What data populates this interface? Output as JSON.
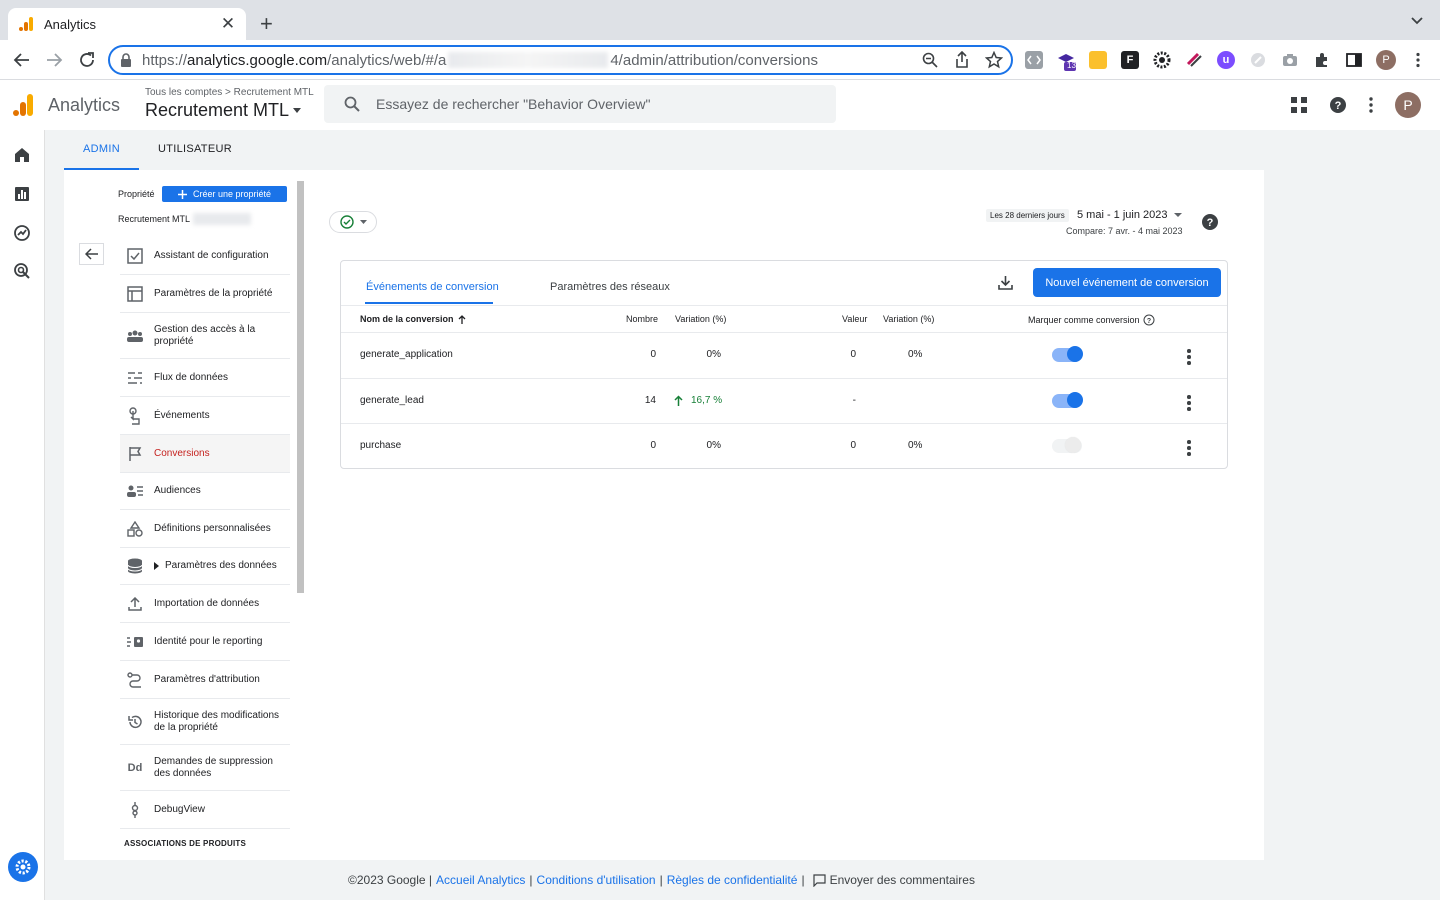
{
  "browser": {
    "tab_title": "Analytics",
    "tab_close": "✕",
    "new_tab": "+",
    "url_scheme": "https://",
    "url_host": "analytics.google.com",
    "url_prefix": "/analytics/web/#/a",
    "url_suffix": "4/admin/attribution/conversions",
    "extension_badge": "13",
    "profile_initial": "P"
  },
  "header": {
    "product": "Analytics",
    "breadcrumb_root": "Tous les comptes",
    "breadcrumb_account": "Recrutement MTL",
    "property_name": "Recrutement MTL",
    "search_placeholder": "Essayez de rechercher \"Behavior Overview\"",
    "avatar_initial": "P"
  },
  "admin_tabs": [
    "ADMIN",
    "UTILISATEUR"
  ],
  "property_bar": {
    "label": "Propriété",
    "create_button": "Créer une propriété",
    "property_name": "Recrutement MTL"
  },
  "menu": [
    {
      "label": "Assistant de configuration",
      "icon": "checklist-icon"
    },
    {
      "label": "Paramètres de la propriété",
      "icon": "property-settings-icon"
    },
    {
      "label": "Gestion des accès à la propriété",
      "icon": "people-icon"
    },
    {
      "label": "Flux de données",
      "icon": "data-streams-icon"
    },
    {
      "label": "Événements",
      "icon": "touch-icon"
    },
    {
      "label": "Conversions",
      "icon": "flag-icon"
    },
    {
      "label": "Audiences",
      "icon": "audiences-icon"
    },
    {
      "label": "Définitions personnalisées",
      "icon": "shapes-icon"
    },
    {
      "label": "Paramètres des données",
      "icon": "database-icon"
    },
    {
      "label": "Importation de données",
      "icon": "upload-icon"
    },
    {
      "label": "Identité pour le reporting",
      "icon": "identity-icon"
    },
    {
      "label": "Paramètres d'attribution",
      "icon": "attribution-icon"
    },
    {
      "label": "Historique des modifications de la propriété",
      "icon": "history-icon"
    },
    {
      "label": "Demandes de suppression des données",
      "icon": "dd-icon"
    },
    {
      "label": "DebugView",
      "icon": "debug-icon"
    }
  ],
  "products_heading": "ASSOCIATIONS DE PRODUITS",
  "date_range": {
    "badge": "Les 28 derniers jours",
    "range": "5 mai - 1 juin 2023",
    "compare": "Compare: 7 avr. - 4 mai 2023"
  },
  "card": {
    "tabs": [
      "Événements de conversion",
      "Paramètres des réseaux"
    ],
    "new_button": "Nouvel événement de conversion",
    "columns": {
      "name": "Nom de la conversion",
      "count": "Nombre",
      "count_variation": "Variation (%)",
      "value": "Valeur",
      "value_variation": "Variation (%)",
      "mark": "Marquer comme conversion"
    },
    "rows": [
      {
        "name": "generate_application",
        "count": "0",
        "count_variation": "0%",
        "value": "0",
        "value_variation": "0%",
        "marked": true
      },
      {
        "name": "generate_lead",
        "count": "14",
        "count_variation": "16,7 %",
        "value": "-",
        "value_variation": "",
        "marked": true
      },
      {
        "name": "purchase",
        "count": "0",
        "count_variation": "0%",
        "value": "0",
        "value_variation": "0%",
        "marked": false
      }
    ]
  },
  "footer": {
    "copyright": "©2023 Google |",
    "links": [
      "Accueil Analytics",
      "Conditions d'utilisation",
      "Règles de confidentialité"
    ],
    "separator": "|",
    "feedback": "Envoyer des commentaires"
  }
}
